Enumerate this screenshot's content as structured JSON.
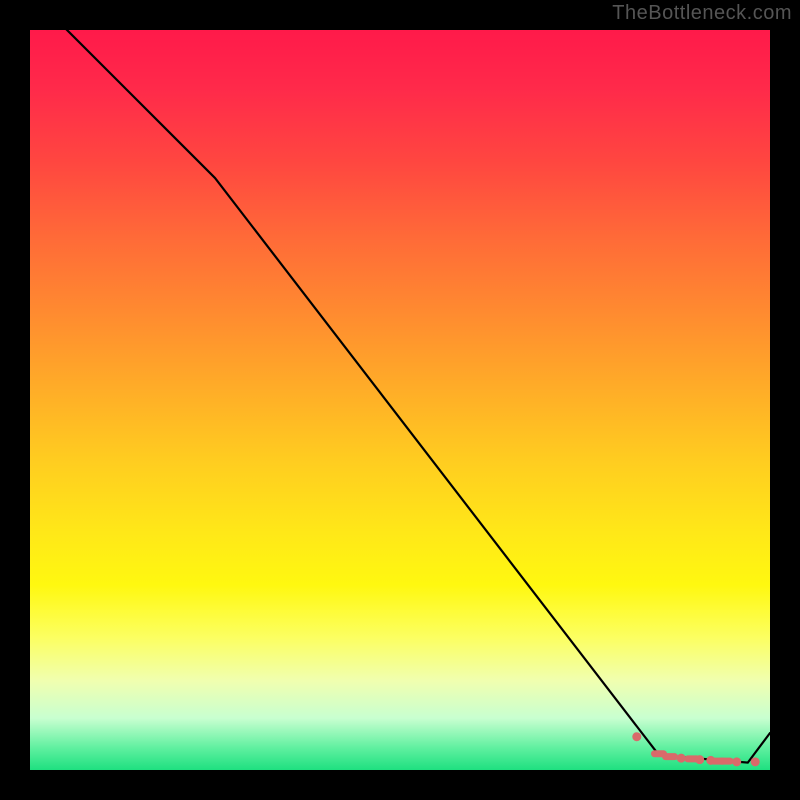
{
  "watermark": "TheBottleneck.com",
  "chart_data": {
    "type": "line",
    "title": "",
    "xlabel": "",
    "ylabel": "",
    "xlim": [
      0,
      100
    ],
    "ylim": [
      0,
      100
    ],
    "series": [
      {
        "name": "curve",
        "x": [
          0,
          25,
          85,
          97,
          100
        ],
        "values": [
          105,
          80,
          2,
          1,
          5
        ]
      }
    ],
    "markers": {
      "name": "dash-cluster",
      "x": [
        82,
        85,
        86.5,
        88,
        89.5,
        90.5,
        92,
        93,
        94,
        95.5,
        98
      ],
      "values": [
        4.5,
        2.2,
        1.8,
        1.6,
        1.5,
        1.4,
        1.3,
        1.2,
        1.2,
        1.1,
        1.1
      ],
      "style": [
        "dot",
        "dash",
        "dash",
        "dot",
        "dash",
        "dot",
        "dot",
        "dash",
        "dash",
        "dot",
        "dot"
      ]
    },
    "gradient_stops": [
      {
        "pos": 0.0,
        "color": "#ff1a4a"
      },
      {
        "pos": 0.5,
        "color": "#ffcc20"
      },
      {
        "pos": 0.8,
        "color": "#fff810"
      },
      {
        "pos": 1.0,
        "color": "#1ee080"
      }
    ]
  }
}
